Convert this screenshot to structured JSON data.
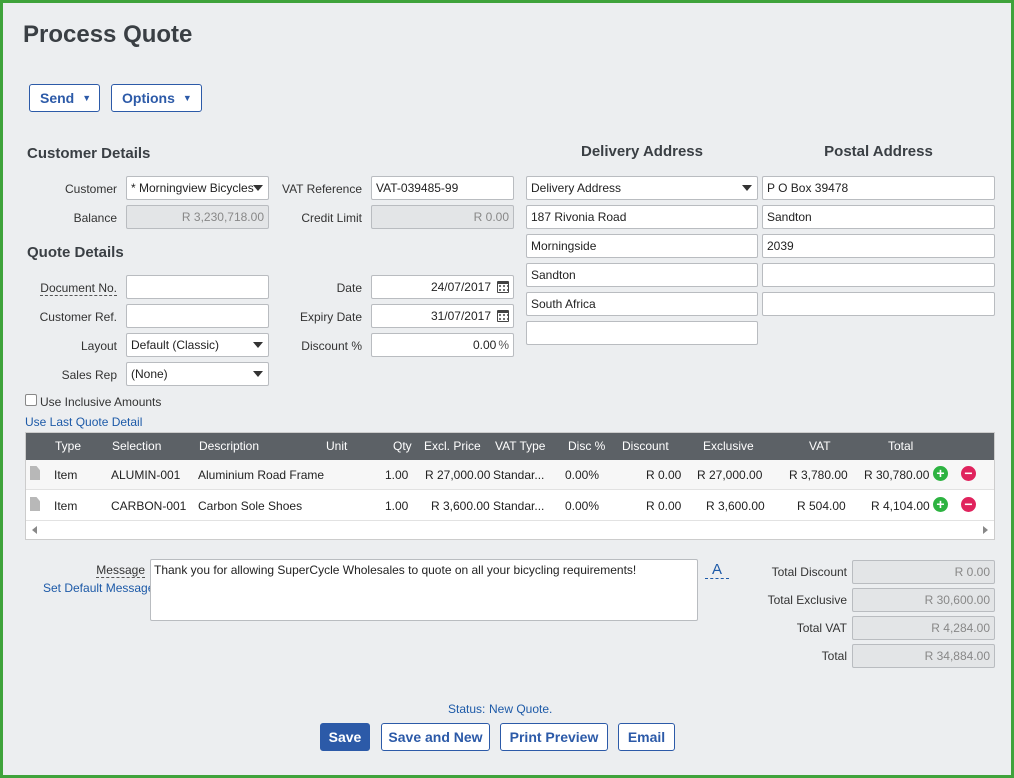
{
  "page": {
    "title": "Process Quote"
  },
  "toolbar": {
    "send_label": "Send",
    "options_label": "Options"
  },
  "customer_details": {
    "heading": "Customer Details",
    "customer_label": "Customer",
    "customer_value": "* Morningview Bicycles",
    "balance_label": "Balance",
    "balance_value": "R 3,230,718.00",
    "vat_ref_label": "VAT Reference",
    "vat_ref_value": "VAT-039485-99",
    "credit_limit_label": "Credit Limit",
    "credit_limit_value": "R 0.00"
  },
  "quote_details": {
    "heading": "Quote Details",
    "document_no_label": "Document No.",
    "document_no_value": "",
    "customer_ref_label": "Customer Ref.",
    "customer_ref_value": "",
    "layout_label": "Layout",
    "layout_value": "Default (Classic)",
    "sales_rep_label": "Sales Rep",
    "sales_rep_value": "(None)",
    "date_label": "Date",
    "date_value": "24/07/2017",
    "expiry_label": "Expiry Date",
    "expiry_value": "31/07/2017",
    "discount_label": "Discount %",
    "discount_value": "0.00",
    "discount_unit": "%"
  },
  "delivery_address": {
    "heading": "Delivery Address",
    "select_value": "Delivery Address",
    "lines": [
      "187 Rivonia Road",
      "Morningside",
      "Sandton",
      "South Africa",
      ""
    ]
  },
  "postal_address": {
    "heading": "Postal Address",
    "lines": [
      "P O Box 39478",
      "Sandton",
      "2039",
      "",
      ""
    ]
  },
  "options": {
    "inclusive_label": "Use Inclusive Amounts",
    "last_quote_link": "Use Last Quote Detail"
  },
  "grid": {
    "columns": [
      "Type",
      "Selection",
      "Description",
      "Unit",
      "Qty",
      "Excl. Price",
      "VAT Type",
      "Disc %",
      "Discount",
      "Exclusive",
      "VAT",
      "Total"
    ],
    "rows": [
      {
        "type": "Item",
        "selection": "ALUMIN-001",
        "description": "Aluminium Road Frame",
        "unit": "",
        "qty": "1.00",
        "excl_price": "R 27,000.00",
        "vat_type": "Standar...",
        "disc_pct": "0.00%",
        "discount": "R 0.00",
        "exclusive": "R 27,000.00",
        "vat": "R 3,780.00",
        "total": "R 30,780.00"
      },
      {
        "type": "Item",
        "selection": "CARBON-001",
        "description": "Carbon Sole Shoes",
        "unit": "",
        "qty": "1.00",
        "excl_price": "R 3,600.00",
        "vat_type": "Standar...",
        "disc_pct": "0.00%",
        "discount": "R 0.00",
        "exclusive": "R 3,600.00",
        "vat": "R 504.00",
        "total": "R 4,104.00"
      }
    ]
  },
  "message": {
    "label": "Message",
    "default_link": "Set Default Message",
    "text": "Thank you for allowing SuperCycle Wholesales to quote on all your bicycling requirements!",
    "font_button": "A"
  },
  "totals": {
    "total_discount_label": "Total Discount",
    "total_discount_value": "R 0.00",
    "total_exclusive_label": "Total Exclusive",
    "total_exclusive_value": "R 30,600.00",
    "total_vat_label": "Total VAT",
    "total_vat_value": "R 4,284.00",
    "total_label": "Total",
    "total_value": "R 34,884.00"
  },
  "status": {
    "label": "Status:",
    "value": "New Quote."
  },
  "actions": {
    "save": "Save",
    "save_new": "Save and New",
    "print_preview": "Print Preview",
    "email": "Email"
  },
  "colors": {
    "accent": "#2c5aa8",
    "frame": "#3fa33b",
    "grid_header": "#5c6166",
    "add": "#2db341",
    "remove": "#e0235d"
  },
  "icons": {
    "calendar": "calendar-icon",
    "document": "document-icon",
    "add": "add-row-icon",
    "remove": "remove-row-icon"
  }
}
